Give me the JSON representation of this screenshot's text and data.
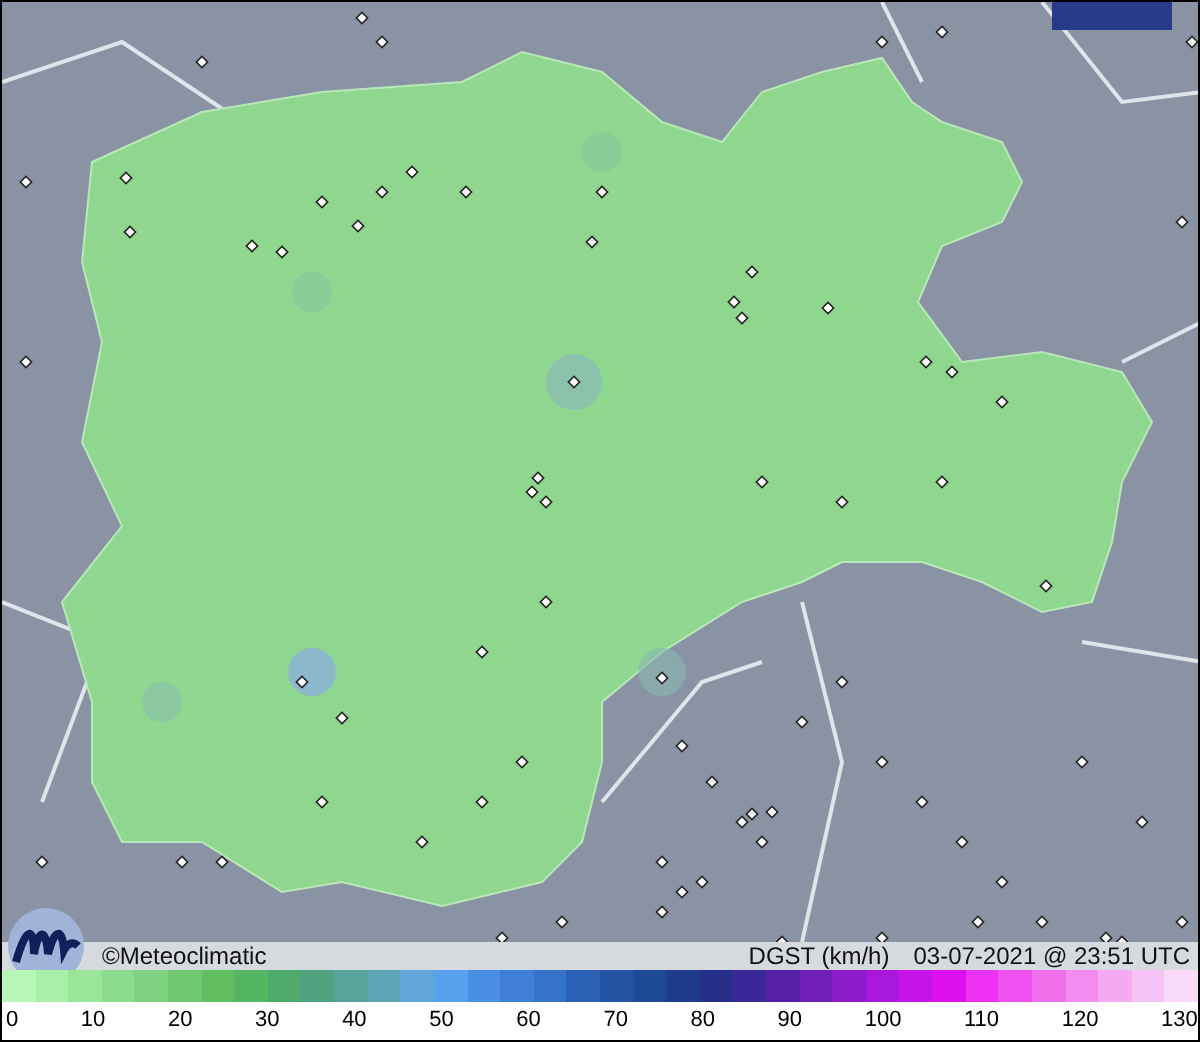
{
  "map": {
    "credit": "©Meteoclimatic",
    "variable": "DGST (km/h)",
    "timestamp": "03-07-2021 @ 23:51 UTC"
  },
  "legend": {
    "ticks": [
      "0",
      "10",
      "20",
      "30",
      "40",
      "50",
      "60",
      "70",
      "80",
      "90",
      "100",
      "110",
      "120",
      "130"
    ]
  }
}
